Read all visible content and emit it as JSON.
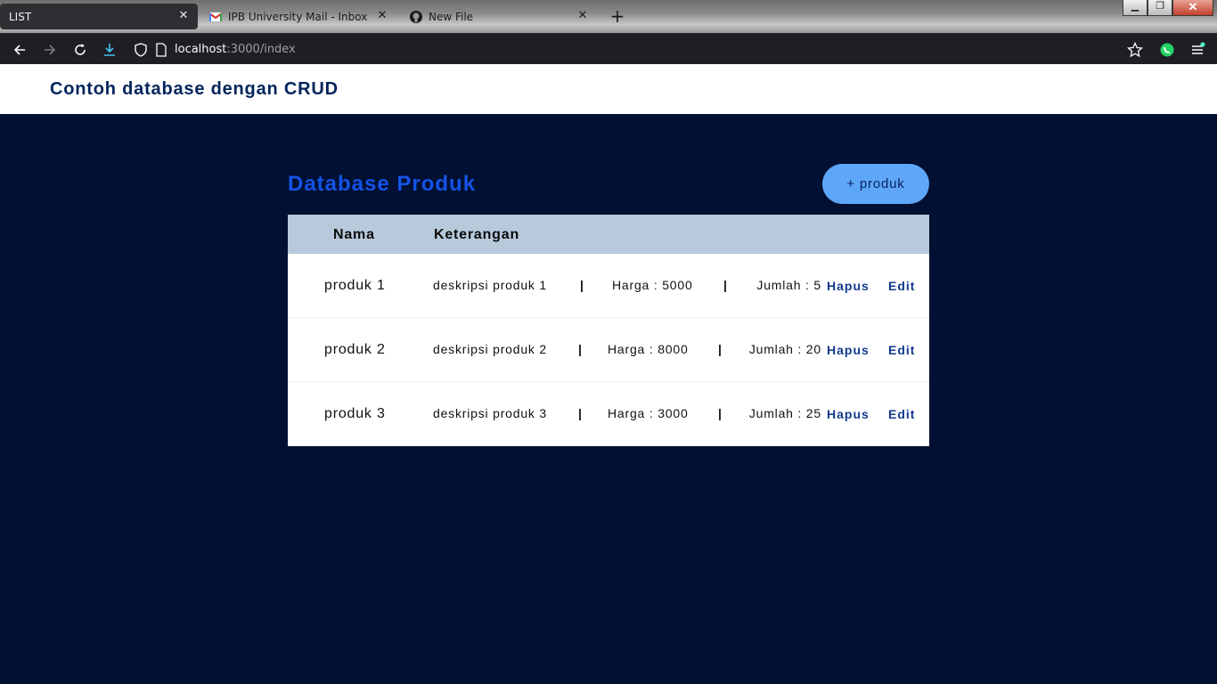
{
  "browser": {
    "tabs": [
      {
        "title": "LIST",
        "active": true
      },
      {
        "title": "IPB University Mail - Inbox",
        "active": false,
        "icon": "gmail-icon"
      },
      {
        "title": "New File",
        "active": false,
        "icon": "github-icon"
      }
    ],
    "new_tab": "+",
    "url_host": "localhost",
    "url_path": ":3000/index",
    "window_controls": {
      "minimize": "▁",
      "restore": "❐",
      "close": "✕"
    }
  },
  "header": {
    "title": "Contoh database dengan CRUD"
  },
  "main": {
    "title": "Database Produk",
    "add_button": "+ produk",
    "columns": {
      "nama": "Nama",
      "keterangan": "Keterangan"
    },
    "rows": [
      {
        "nama": "produk 1",
        "deskripsi": "deskripsi produk 1",
        "separator": "|",
        "harga": "Harga : 5000",
        "jumlah": "Jumlah : 5",
        "hapus": "Hapus",
        "edit": "Edit"
      },
      {
        "nama": "produk 2",
        "deskripsi": "deskripsi produk 2",
        "separator": "|",
        "harga": "Harga : 8000",
        "jumlah": "Jumlah : 20",
        "hapus": "Hapus",
        "edit": "Edit"
      },
      {
        "nama": "produk 3",
        "deskripsi": "deskripsi produk 3",
        "separator": "|",
        "harga": "Harga : 3000",
        "jumlah": "Jumlah : 25",
        "hapus": "Hapus",
        "edit": "Edit"
      }
    ]
  },
  "colors": {
    "background": "#011033",
    "title_accent": "#1552e6",
    "button": "#5ea6f8",
    "table_header": "#b7c9da",
    "link": "#133a8c"
  }
}
